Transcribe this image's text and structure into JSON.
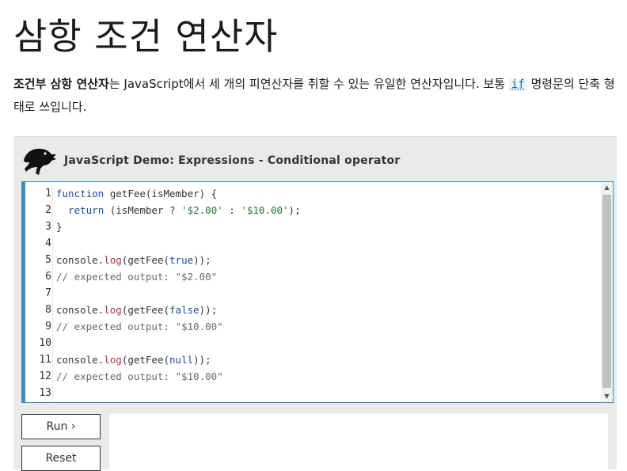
{
  "page": {
    "title": "삼항 조건 연산자",
    "intro_bold": "조건부 삼항 연산자",
    "intro_text_1": "는 JavaScript에서 세 개의 피연산자를 취할 수 있는 유일한 연산자입니다. 보통 ",
    "intro_code": "if",
    "intro_text_2": " 명령문의 단축 형태로 쓰입니다."
  },
  "demo": {
    "title": "JavaScript Demo: Expressions - Conditional operator",
    "logo_icon": "dinosaur-logo-icon",
    "run_label": "Run ›",
    "reset_label": "Reset",
    "code_lines": [
      "function getFee(isMember) {",
      "  return (isMember ? '$2.00' : '$10.00');",
      "}",
      "",
      "console.log(getFee(true));",
      "// expected output: \"$2.00\"",
      "",
      "console.log(getFee(false));",
      "// expected output: \"$10.00\"",
      "",
      "console.log(getFee(null));",
      "// expected output: \"$10.00\"",
      ""
    ],
    "line_numbers": [
      "1",
      "2",
      "3",
      "4",
      "5",
      "6",
      "7",
      "8",
      "9",
      "10",
      "11",
      "12",
      "13"
    ]
  },
  "colors": {
    "editor_border": "#3f8fb8",
    "keyword": "#1a4e9a",
    "string": "#1f7a32",
    "comment": "#6b6b6b",
    "method": "#b23a3a"
  }
}
